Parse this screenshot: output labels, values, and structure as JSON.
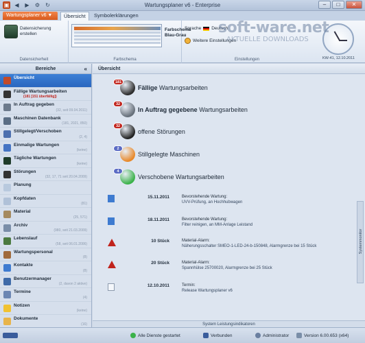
{
  "window": {
    "title": "Wartungsplaner v6 - Enterprise"
  },
  "app_tab": {
    "label": "Wartungsplaner v6 ▼"
  },
  "ribbon_tabs": [
    {
      "label": "Übersicht"
    },
    {
      "label": "Symbolerklärungen"
    }
  ],
  "ribbon": {
    "backup_label": "Datensicherung erstellen",
    "group_data": "Datensicherheit",
    "schema_label": "Farbschema Blau-Grau",
    "group_color": "Farbschema",
    "language_label": "Sprache",
    "language_value": "Deutsch",
    "more_settings_label": "Weitere Einstellungen",
    "group_settings": "Einstellungen",
    "kw_date": "KW-41, 12.10.2011"
  },
  "watermark": {
    "main": "soft-ware.net",
    "sub": "AKTUELLE DOWNLOADS"
  },
  "sidebar": {
    "header": "Bereiche",
    "collapse_glyph": "«",
    "items": [
      {
        "label": "Übersicht",
        "sub": "",
        "color": "#c24a2a"
      },
      {
        "label": "Fällige Wartungsarbeiten",
        "sub": "(181 [151 überfällig])",
        "color": "#333333"
      },
      {
        "label": "In Auftrag gegeben",
        "sub": "(32, seit 09.04.2011)",
        "color": "#6c7a8c"
      },
      {
        "label": "Maschinen Datenbank",
        "sub": "(181, 2021, 850)",
        "color": "#5a6d84"
      },
      {
        "label": "Stillgelegt/Verschoben",
        "sub": "(2, 4)",
        "color": "#4c6fae"
      },
      {
        "label": "Einmalige Wartungen",
        "sub": "(keine)",
        "color": "#4474c4"
      },
      {
        "label": "Tägliche Wartungen",
        "sub": "(keine)",
        "color": "#1e3b2a"
      },
      {
        "label": "Störungen",
        "sub": "(32, 17, 71 seit 20.04.2009)",
        "color": "#333333"
      },
      {
        "label": "Planung",
        "sub": "",
        "color": "#b8c9de"
      },
      {
        "label": "Kopfdaten",
        "sub": "(81)",
        "color": "#b0c1d8"
      },
      {
        "label": "Material",
        "sub": "(25, 571)",
        "color": "#a58a5f"
      },
      {
        "label": "Archiv",
        "sub": "(980, seit 21.03.2009)",
        "color": "#7a8ea8"
      },
      {
        "label": "Lebenslauf",
        "sub": "(58, seit 06.01.2006)",
        "color": "#4b7a40"
      },
      {
        "label": "Wartungspersonal",
        "sub": "(8)",
        "color": "#a06a3c"
      },
      {
        "label": "Kontakte",
        "sub": "(8)",
        "color": "#3e7bd0"
      },
      {
        "label": "Benutzermanager",
        "sub": "(2, davon 2 aktive)",
        "color": "#3e6aa8"
      },
      {
        "label": "Termine",
        "sub": "(4)",
        "color": "#6b86b3"
      },
      {
        "label": "Notizen",
        "sub": "(keine)",
        "color": "#f1c232"
      },
      {
        "label": "Dokumente",
        "sub": "(16)",
        "color": "#e8b44a"
      }
    ],
    "active_index": 0
  },
  "main": {
    "header": "Übersicht",
    "tiles": [
      {
        "badge": "181",
        "bold": "Fällige",
        "text": " Wartungsarbeiten",
        "badge_color": "#c0231c",
        "icon_color": "#2d2d2d"
      },
      {
        "badge": "32",
        "bold": "In Auftrag gegebene",
        "text": " Wartungsarbeiten",
        "badge_color": "#c0231c",
        "icon_color": "#666f7a"
      },
      {
        "badge": "32",
        "bold": "",
        "text": "offene Störungen",
        "badge_color": "#c0231c",
        "icon_color": "#222222"
      },
      {
        "badge": "2",
        "bold": "",
        "text": "Stillgelegte Maschinen",
        "badge_color": "#5a6bc4",
        "icon_color": "#e8892a"
      },
      {
        "badge": "4",
        "bold": "",
        "text": "Verschobene Wartungsarbeiten",
        "badge_color": "#5a6bc4",
        "icon_color": "#3bb24a"
      }
    ],
    "events": [
      {
        "type": "info-icon",
        "date": "15.11.2011",
        "title": "Bevorstehende Wartung:",
        "desc": "UVV-Prüfung, an Hochhubwagen"
      },
      {
        "type": "info-icon",
        "date": "18.11.2011",
        "title": "Bevorstehende Wartung:",
        "desc": "Filter reinigen, an MM-Anlage Leistand"
      },
      {
        "type": "warning-icon",
        "date": "10 Stück",
        "title": "Material-Alarm:",
        "desc": "Näherungsschalter SMEO-1-LED-24-b-150848, Alarmgrenze bei 15 Stück"
      },
      {
        "type": "warning-icon",
        "date": "20 Stück",
        "title": "Material-Alarm:",
        "desc": "Spannhülse 25700020, Alarmgrenze bei 25 Stück"
      },
      {
        "type": "note-icon",
        "date": "12.10.2011",
        "title": "Termin:",
        "desc": "Release Wartungsplaner v6"
      }
    ],
    "footer": "System Leistungsindikatoren",
    "side_tab": "Systemmonitor"
  },
  "status": {
    "services": "Alle Dienste gestartet",
    "connection": "Verbunden",
    "user": "Administrator",
    "version": "Version 6.00.653 (x64)"
  },
  "colors": {
    "accent": "#3d80d6",
    "brand_orange": "#d85a1c"
  }
}
